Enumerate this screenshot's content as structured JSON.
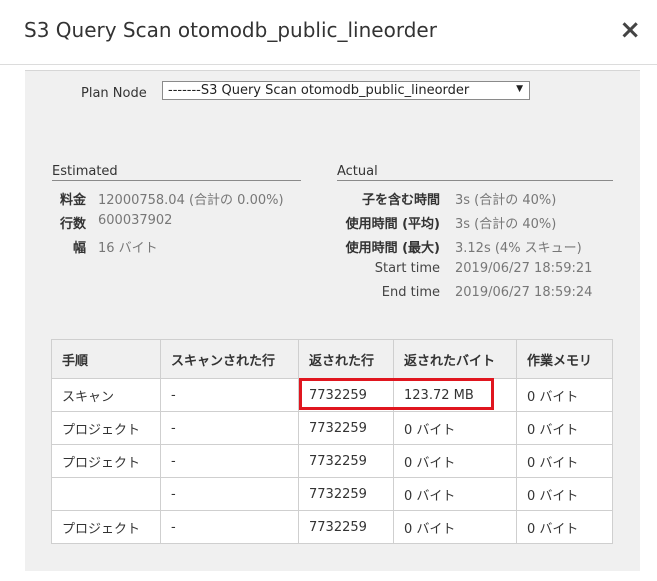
{
  "dialog": {
    "title": "S3 Query Scan otomodb_public_lineorder",
    "close_glyph": "×"
  },
  "plan_node": {
    "label": "Plan Node",
    "selected": "-------S3 Query Scan otomodb_public_lineorder",
    "arrow": "▼"
  },
  "estimated": {
    "title": "Estimated",
    "rows": [
      {
        "key": "料金",
        "value": "12000758.04 (合計の 0.00%)"
      },
      {
        "key": "行数",
        "value": "600037902"
      },
      {
        "key": "幅",
        "value": "16 バイト"
      }
    ]
  },
  "actual": {
    "title": "Actual",
    "rows": [
      {
        "key": "子を含む時間",
        "value": "3s (合計の 40%)"
      },
      {
        "key": "使用時間 (平均)",
        "value": "3s (合計の 40%)"
      },
      {
        "key": "使用時間 (最大)",
        "value": "3.12s (4% スキュー)"
      },
      {
        "key": "Start time",
        "value": "2019/06/27 18:59:21"
      },
      {
        "key": "End time",
        "value": "2019/06/27 18:59:24"
      }
    ]
  },
  "steps_table": {
    "headers": [
      "手順",
      "スキャンされた行",
      "返された行",
      "返されたバイト",
      "作業メモリ"
    ],
    "rows": [
      [
        "スキャン",
        "-",
        "7732259",
        "123.72 MB",
        "0 バイト"
      ],
      [
        "プロジェクト",
        "-",
        "7732259",
        "0 バイト",
        "0 バイト"
      ],
      [
        "プロジェクト",
        "-",
        "7732259",
        "0 バイト",
        "0 バイト"
      ],
      [
        "",
        "-",
        "7732259",
        "0 バイト",
        "0 バイト"
      ],
      [
        "プロジェクト",
        "-",
        "7732259",
        "0 バイト",
        "0 バイト"
      ]
    ]
  },
  "colors": {
    "highlight": "#e0161f",
    "panel_bg": "#f0f0f0"
  }
}
